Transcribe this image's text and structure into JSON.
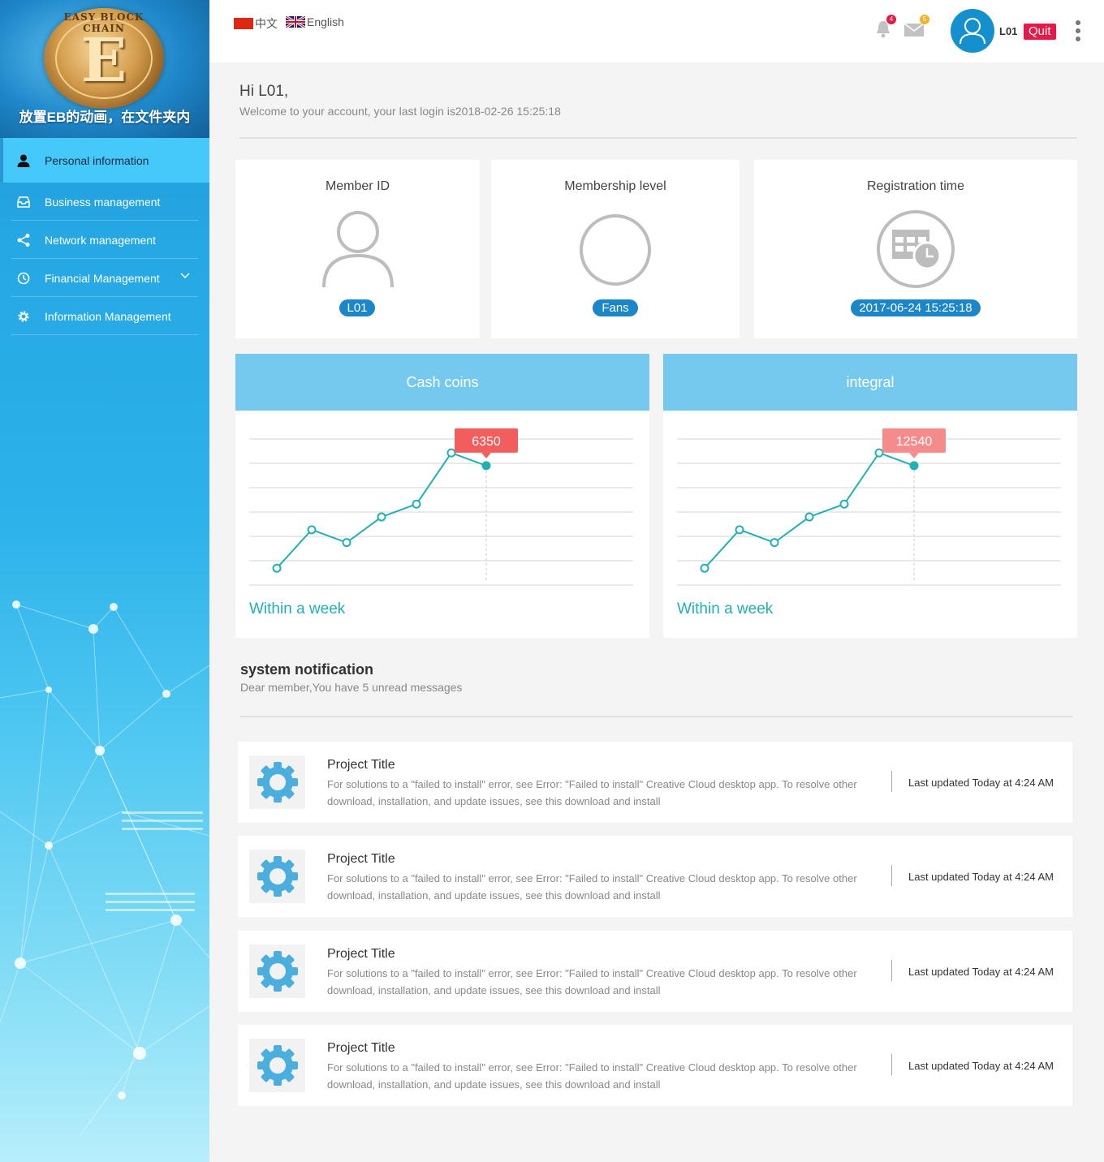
{
  "sidebar": {
    "brand_caption": "放置EB的动画，在文件夹内",
    "logo_text": "EASY BLOCK CHAIN",
    "logo_letter": "E",
    "items": [
      {
        "label": "Personal information",
        "icon": "user-icon"
      },
      {
        "label": "Business management",
        "icon": "inbox-icon"
      },
      {
        "label": "Network management",
        "icon": "share-icon"
      },
      {
        "label": "Financial Management",
        "icon": "finance-icon"
      },
      {
        "label": "Information Management",
        "icon": "gear-icon"
      }
    ]
  },
  "topbar": {
    "lang_cn": "中文",
    "lang_en": "English",
    "notif_count": "4",
    "mail_count": "5",
    "username": "L01",
    "quit_label": "Quit"
  },
  "welcome": {
    "hi": "Hi  L01,",
    "sub": "Welcome to your account, your last login is2018-02-26 15:25:18"
  },
  "cards": {
    "member_id": {
      "title": "Member ID",
      "value": "L01"
    },
    "membership": {
      "title": "Membership level",
      "value": "Fans"
    },
    "registration": {
      "title": "Registration time",
      "value": "2017-06-24 15:25:18"
    }
  },
  "charts": {
    "cash": {
      "title": "Cash coins",
      "footer": "Within a week",
      "tooltip": "6350"
    },
    "integral": {
      "title": "integral",
      "footer": "Within a week",
      "tooltip": "12540"
    }
  },
  "chart_data": [
    {
      "type": "line",
      "title": "Cash coins",
      "y_relative": [
        1,
        4,
        3,
        5,
        6,
        10,
        9
      ],
      "highlight_index": 6,
      "highlight_value": 6350,
      "accent": "#21b0b3",
      "tooltip_color": "#f25d5d"
    },
    {
      "type": "line",
      "title": "integral",
      "y_relative": [
        1,
        4,
        3,
        5,
        6,
        10,
        9
      ],
      "highlight_index": 6,
      "highlight_value": 12540,
      "accent": "#21b0b3",
      "tooltip_color": "#f58b8b"
    }
  ],
  "notifications": {
    "title": "system notification",
    "sub": "Dear member,You have 5 unread messages",
    "items": [
      {
        "title": "Project Title",
        "body": "For solutions to a \"failed to install\" error, see Error: \"Failed to install\" Creative Cloud desktop app. To resolve other download, installation, and update issues, see this download and install",
        "time": "Last updated Today at 4:24 AM"
      },
      {
        "title": "Project Title",
        "body": "For solutions to a \"failed to install\" error, see Error: \"Failed to install\" Creative Cloud desktop app. To resolve other download, installation, and update issues, see this download and install",
        "time": "Last updated Today at 4:24 AM"
      },
      {
        "title": "Project Title",
        "body": "For solutions to a \"failed to install\" error, see Error: \"Failed to install\" Creative Cloud desktop app. To resolve other download, installation, and update issues, see this download and install",
        "time": "Last updated Today at 4:24 AM"
      },
      {
        "title": "Project Title",
        "body": "For solutions to a \"failed to install\" error, see Error: \"Failed to install\" Creative Cloud desktop app. To resolve other download, installation, and update issues, see this download and install",
        "time": "Last updated Today at 4:24 AM"
      }
    ]
  },
  "colors": {
    "accent": "#1b86c8",
    "sidebar_active": "#45c9fb",
    "quit": "#e8194a",
    "chart_head": "#75c8ee",
    "chart_line": "#21b0b3"
  }
}
